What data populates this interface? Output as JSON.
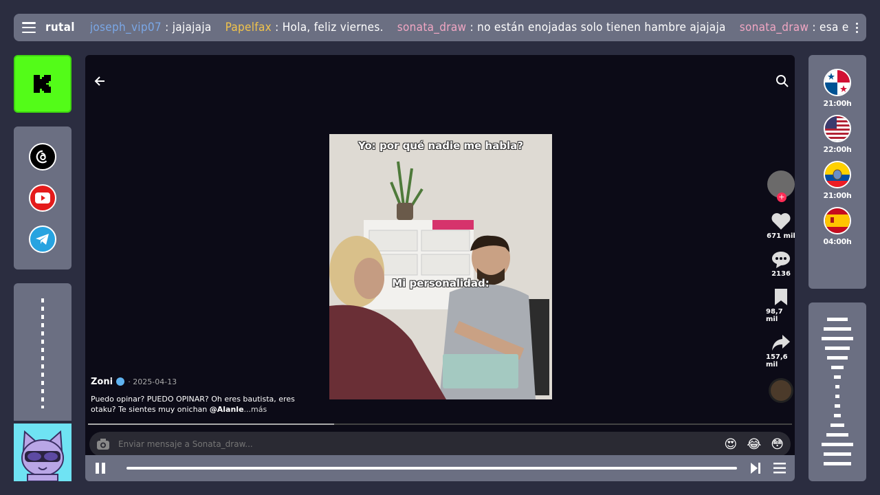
{
  "ticker": {
    "channel": "rutal",
    "messages": [
      {
        "user": "joseph_vip07",
        "text": " : jajajaja",
        "color": "#7aa7e6"
      },
      {
        "user": "Papelfax",
        "text": " : Hola, feliz viernes.",
        "color": "#f2c44b"
      },
      {
        "user": "sonata_draw",
        "text": " : no están enojadas solo tienen hambre ajajaja",
        "color": "#f1a6c3"
      },
      {
        "user": "sonata_draw",
        "text": " : esa era yo",
        "color": "#f1a6c3"
      }
    ]
  },
  "socials": [
    "threads-icon",
    "youtube-icon",
    "telegram-icon"
  ],
  "video": {
    "caption_top": "Yo: por qué nadie me habla?",
    "caption_mid": "Mi personalidad:"
  },
  "actions": {
    "likes": "671 mil",
    "comments": "2136",
    "saves": "98,7 mil",
    "shares": "157,6 mil"
  },
  "post": {
    "author": "Zoni",
    "date": "· 2025-04-13",
    "body": "Puedo opinar? PUEDO OPINAR? Oh eres bautista, eres otaku? Te sientes muy onichan ",
    "tag": "@Alanle",
    "more": "...más"
  },
  "message_bar": {
    "placeholder": "Enviar mensaje a Sonata_draw...",
    "emojis": [
      "😍",
      "😂",
      "😳"
    ]
  },
  "schedule": [
    {
      "country": "panama",
      "time": "21:00h"
    },
    {
      "country": "usa",
      "time": "22:00h"
    },
    {
      "country": "ecuador",
      "time": "21:00h"
    },
    {
      "country": "spain",
      "time": "04:00h"
    }
  ],
  "colors": {
    "kick_green": "#53fc18",
    "panel": "#6b6f82",
    "background": "#2b2d40"
  }
}
